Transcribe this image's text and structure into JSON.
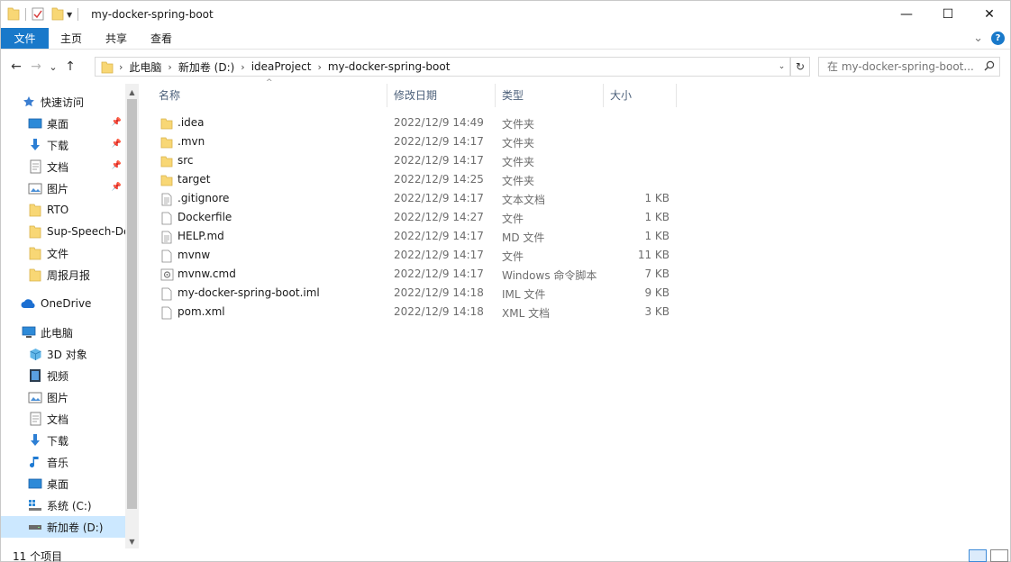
{
  "window": {
    "title": "my-docker-spring-boot",
    "minimize": "—",
    "maximize": "☐",
    "close": "✕"
  },
  "ribbon": {
    "tabs": [
      {
        "label": "文件"
      },
      {
        "label": "主页"
      },
      {
        "label": "共享"
      },
      {
        "label": "查看"
      }
    ],
    "collapse": "⌄",
    "help": "?"
  },
  "nav": {
    "back": "←",
    "forward": "→",
    "recent": "⌄",
    "up": "↑",
    "breadcrumbs": [
      {
        "label": "此电脑"
      },
      {
        "label": "新加卷 (D:)"
      },
      {
        "label": "ideaProject"
      },
      {
        "label": "my-docker-spring-boot"
      }
    ],
    "dropdown": "⌄",
    "refresh": "↻",
    "search_placeholder": "在 my-docker-spring-boot..."
  },
  "sidebar": {
    "quick_access": "快速访问",
    "quick_items": [
      {
        "label": "桌面",
        "icon": "desktop-icon",
        "pinned": true
      },
      {
        "label": "下载",
        "icon": "download-icon",
        "pinned": true
      },
      {
        "label": "文档",
        "icon": "document-icon",
        "pinned": true
      },
      {
        "label": "图片",
        "icon": "picture-icon",
        "pinned": true
      },
      {
        "label": "RTO",
        "icon": "folder-icon",
        "pinned": false
      },
      {
        "label": "Sup-Speech-De",
        "icon": "folder-icon",
        "pinned": false
      },
      {
        "label": "文件",
        "icon": "folder-icon",
        "pinned": false
      },
      {
        "label": "周报月报",
        "icon": "folder-icon",
        "pinned": false
      }
    ],
    "onedrive": "OneDrive",
    "this_pc": "此电脑",
    "pc_items": [
      {
        "label": "3D 对象",
        "icon": "cube-3d-icon"
      },
      {
        "label": "视频",
        "icon": "video-icon"
      },
      {
        "label": "图片",
        "icon": "picture-icon"
      },
      {
        "label": "文档",
        "icon": "document-icon"
      },
      {
        "label": "下载",
        "icon": "download-icon"
      },
      {
        "label": "音乐",
        "icon": "music-icon"
      },
      {
        "label": "桌面",
        "icon": "desktop-icon"
      },
      {
        "label": "系统 (C:)",
        "icon": "drive-c-icon"
      },
      {
        "label": "新加卷 (D:)",
        "icon": "drive-icon",
        "selected": true
      }
    ]
  },
  "columns": {
    "name": "名称",
    "date": "修改日期",
    "type": "类型",
    "size": "大小",
    "sort_indicator": "^"
  },
  "files": [
    {
      "name": ".idea",
      "date": "2022/12/9 14:49",
      "type": "文件夹",
      "size": "",
      "icon": "folder-icon"
    },
    {
      "name": ".mvn",
      "date": "2022/12/9 14:17",
      "type": "文件夹",
      "size": "",
      "icon": "folder-icon"
    },
    {
      "name": "src",
      "date": "2022/12/9 14:17",
      "type": "文件夹",
      "size": "",
      "icon": "folder-icon"
    },
    {
      "name": "target",
      "date": "2022/12/9 14:25",
      "type": "文件夹",
      "size": "",
      "icon": "folder-icon"
    },
    {
      "name": ".gitignore",
      "date": "2022/12/9 14:17",
      "type": "文本文档",
      "size": "1 KB",
      "icon": "text-file-icon"
    },
    {
      "name": "Dockerfile",
      "date": "2022/12/9 14:27",
      "type": "文件",
      "size": "1 KB",
      "icon": "file-icon"
    },
    {
      "name": "HELP.md",
      "date": "2022/12/9 14:17",
      "type": "MD 文件",
      "size": "1 KB",
      "icon": "text-file-icon"
    },
    {
      "name": "mvnw",
      "date": "2022/12/9 14:17",
      "type": "文件",
      "size": "11 KB",
      "icon": "file-icon"
    },
    {
      "name": "mvnw.cmd",
      "date": "2022/12/9 14:17",
      "type": "Windows 命令脚本",
      "size": "7 KB",
      "icon": "cmd-file-icon"
    },
    {
      "name": "my-docker-spring-boot.iml",
      "date": "2022/12/9 14:18",
      "type": "IML 文件",
      "size": "9 KB",
      "icon": "file-icon"
    },
    {
      "name": "pom.xml",
      "date": "2022/12/9 14:18",
      "type": "XML 文档",
      "size": "3 KB",
      "icon": "file-icon"
    }
  ],
  "status": {
    "count": "11 个项目"
  },
  "colors": {
    "accent": "#1979ca",
    "folder": "#f8d775",
    "selection": "#cce8ff"
  }
}
